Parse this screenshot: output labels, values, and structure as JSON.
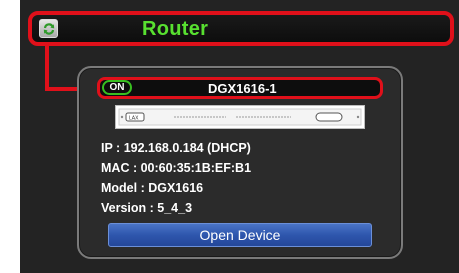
{
  "router": {
    "title": "Router",
    "icon": "refresh-icon"
  },
  "device": {
    "status": "ON",
    "name": "DGX1616-1",
    "ip": "IP : 192.168.0.184 (DHCP)",
    "mac": "MAC : 00:60:35:1B:EF:B1",
    "model": "Model : DGX1616",
    "version": "Version : 5_4_3",
    "open_label": "Open Device",
    "image": "device-front-panel"
  },
  "colors": {
    "accent_red": "#e0101a",
    "title_green": "#58e030",
    "status_green": "#38c020",
    "button_blue": "#2e56ad"
  }
}
